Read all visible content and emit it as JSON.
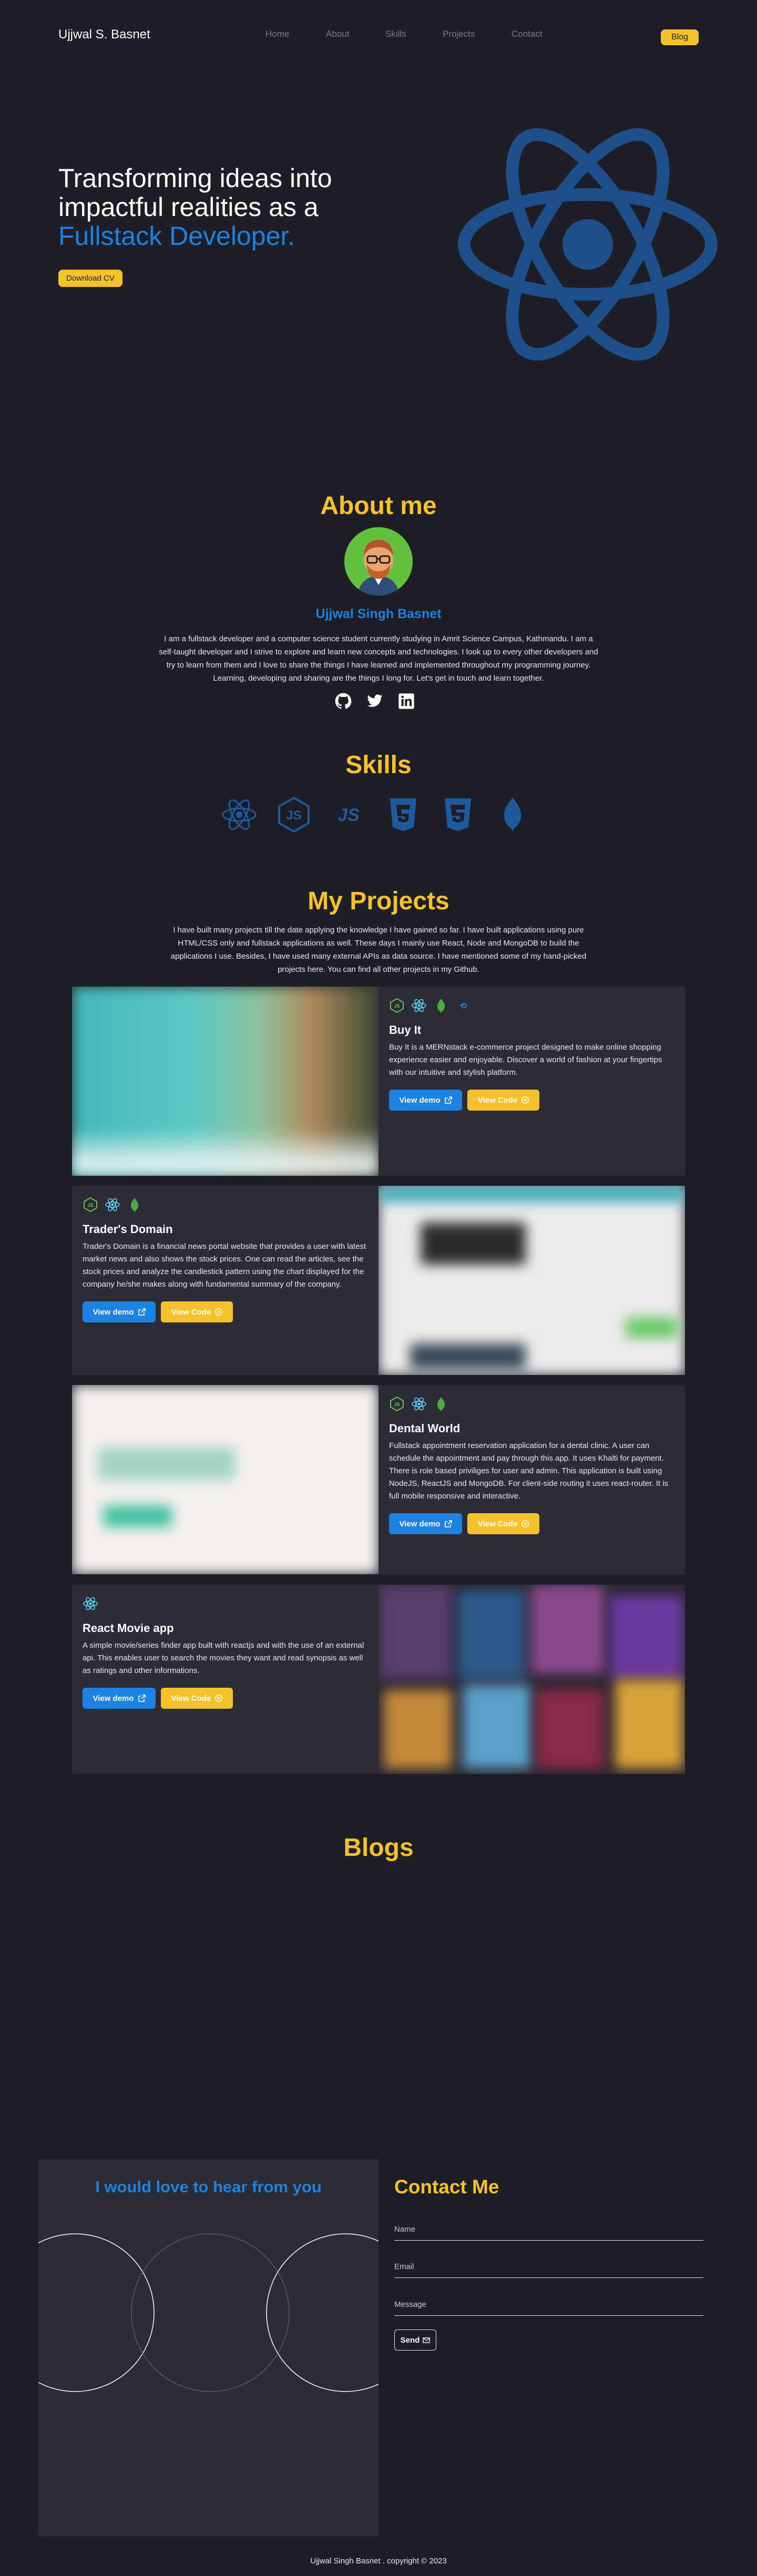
{
  "nav": {
    "brand": "Ujjwal S. Basnet",
    "links": [
      "Home",
      "About",
      "Skills",
      "Projects",
      "Contact"
    ],
    "blog_label": "Blog"
  },
  "hero": {
    "line1": "Transforming ideas into",
    "line2": "impactful realities as a",
    "accent": "Fullstack Developer.",
    "download_label": "Download CV"
  },
  "about": {
    "title": "About me",
    "name": "Ujjwal Singh Basnet",
    "text": "I am a fullstack developer and a computer science student currently studying in Amrit Science Campus, Kathmandu. I am a self-taught developer and I strive to explore and learn new concepts and technologies. I look up to every other developers and try to learn from them and I love to share the things I have learned and implemented throughout my programming journey. Learning, developing and sharing are the things I long for. Let's get in touch and learn together."
  },
  "skills": {
    "title": "Skills"
  },
  "projects": {
    "title": "My Projects",
    "intro": "I have built many projects till the date applying the knowledge I have gained so far. I have built applications using pure HTML/CSS only and fullstack applications as well. These days I mainly use React, Node and MongoDB to build the applications I use. Besides, I have used many external APIs as data source. I have mentioned some of my hand-picked projects here. You can find all other projects in my Github.",
    "demo_label": "View demo",
    "code_label": "View Code",
    "items": [
      {
        "title": "Buy It",
        "desc": "Buy It is a MERNstack e-commerce project designed to make online shopping experience easier and enjoyable. Discover a world of fashion at your fingertips with our intuitive and stylish platform."
      },
      {
        "title": "Trader's Domain",
        "desc": "Trader's Domain is a financial news portal website that provides a user with latest market news and also shows the stock prices. One can read the articles, see the stock prices and analyze the candlestick pattern using the chart displayed for the company he/she makes along with fundamental summary of the company."
      },
      {
        "title": "Dental World",
        "desc": "Fullstack appointment reservation application for a dental clinic. A user can schedule the appointment and pay through this app. It uses Khalti for payment. There is role based priviliges for user and admin. This application is built using NodeJS, ReactJS and MongoDB. For client-side routing it uses react-router. It is full mobile responsive and interactive."
      },
      {
        "title": "React Movie app",
        "desc": "A simple movie/series finder app built with reactjs and with the use of an external api. This enables user to search the movies they want and read synopsis as well as ratings and other informations."
      }
    ]
  },
  "blogs": {
    "title": "Blogs"
  },
  "contact": {
    "left_title": "I would love to hear from you",
    "title": "Contact Me",
    "name_placeholder": "Name",
    "email_placeholder": "Email",
    "message_placeholder": "Message",
    "send_label": "Send"
  },
  "footer": "Ujjwal Singh Basnet . copyright © 2023",
  "colors": {
    "background": "#1e1e26",
    "accent_yellow": "#f5c22b",
    "accent_blue": "#1d82e0",
    "card": "#2c2c36"
  }
}
